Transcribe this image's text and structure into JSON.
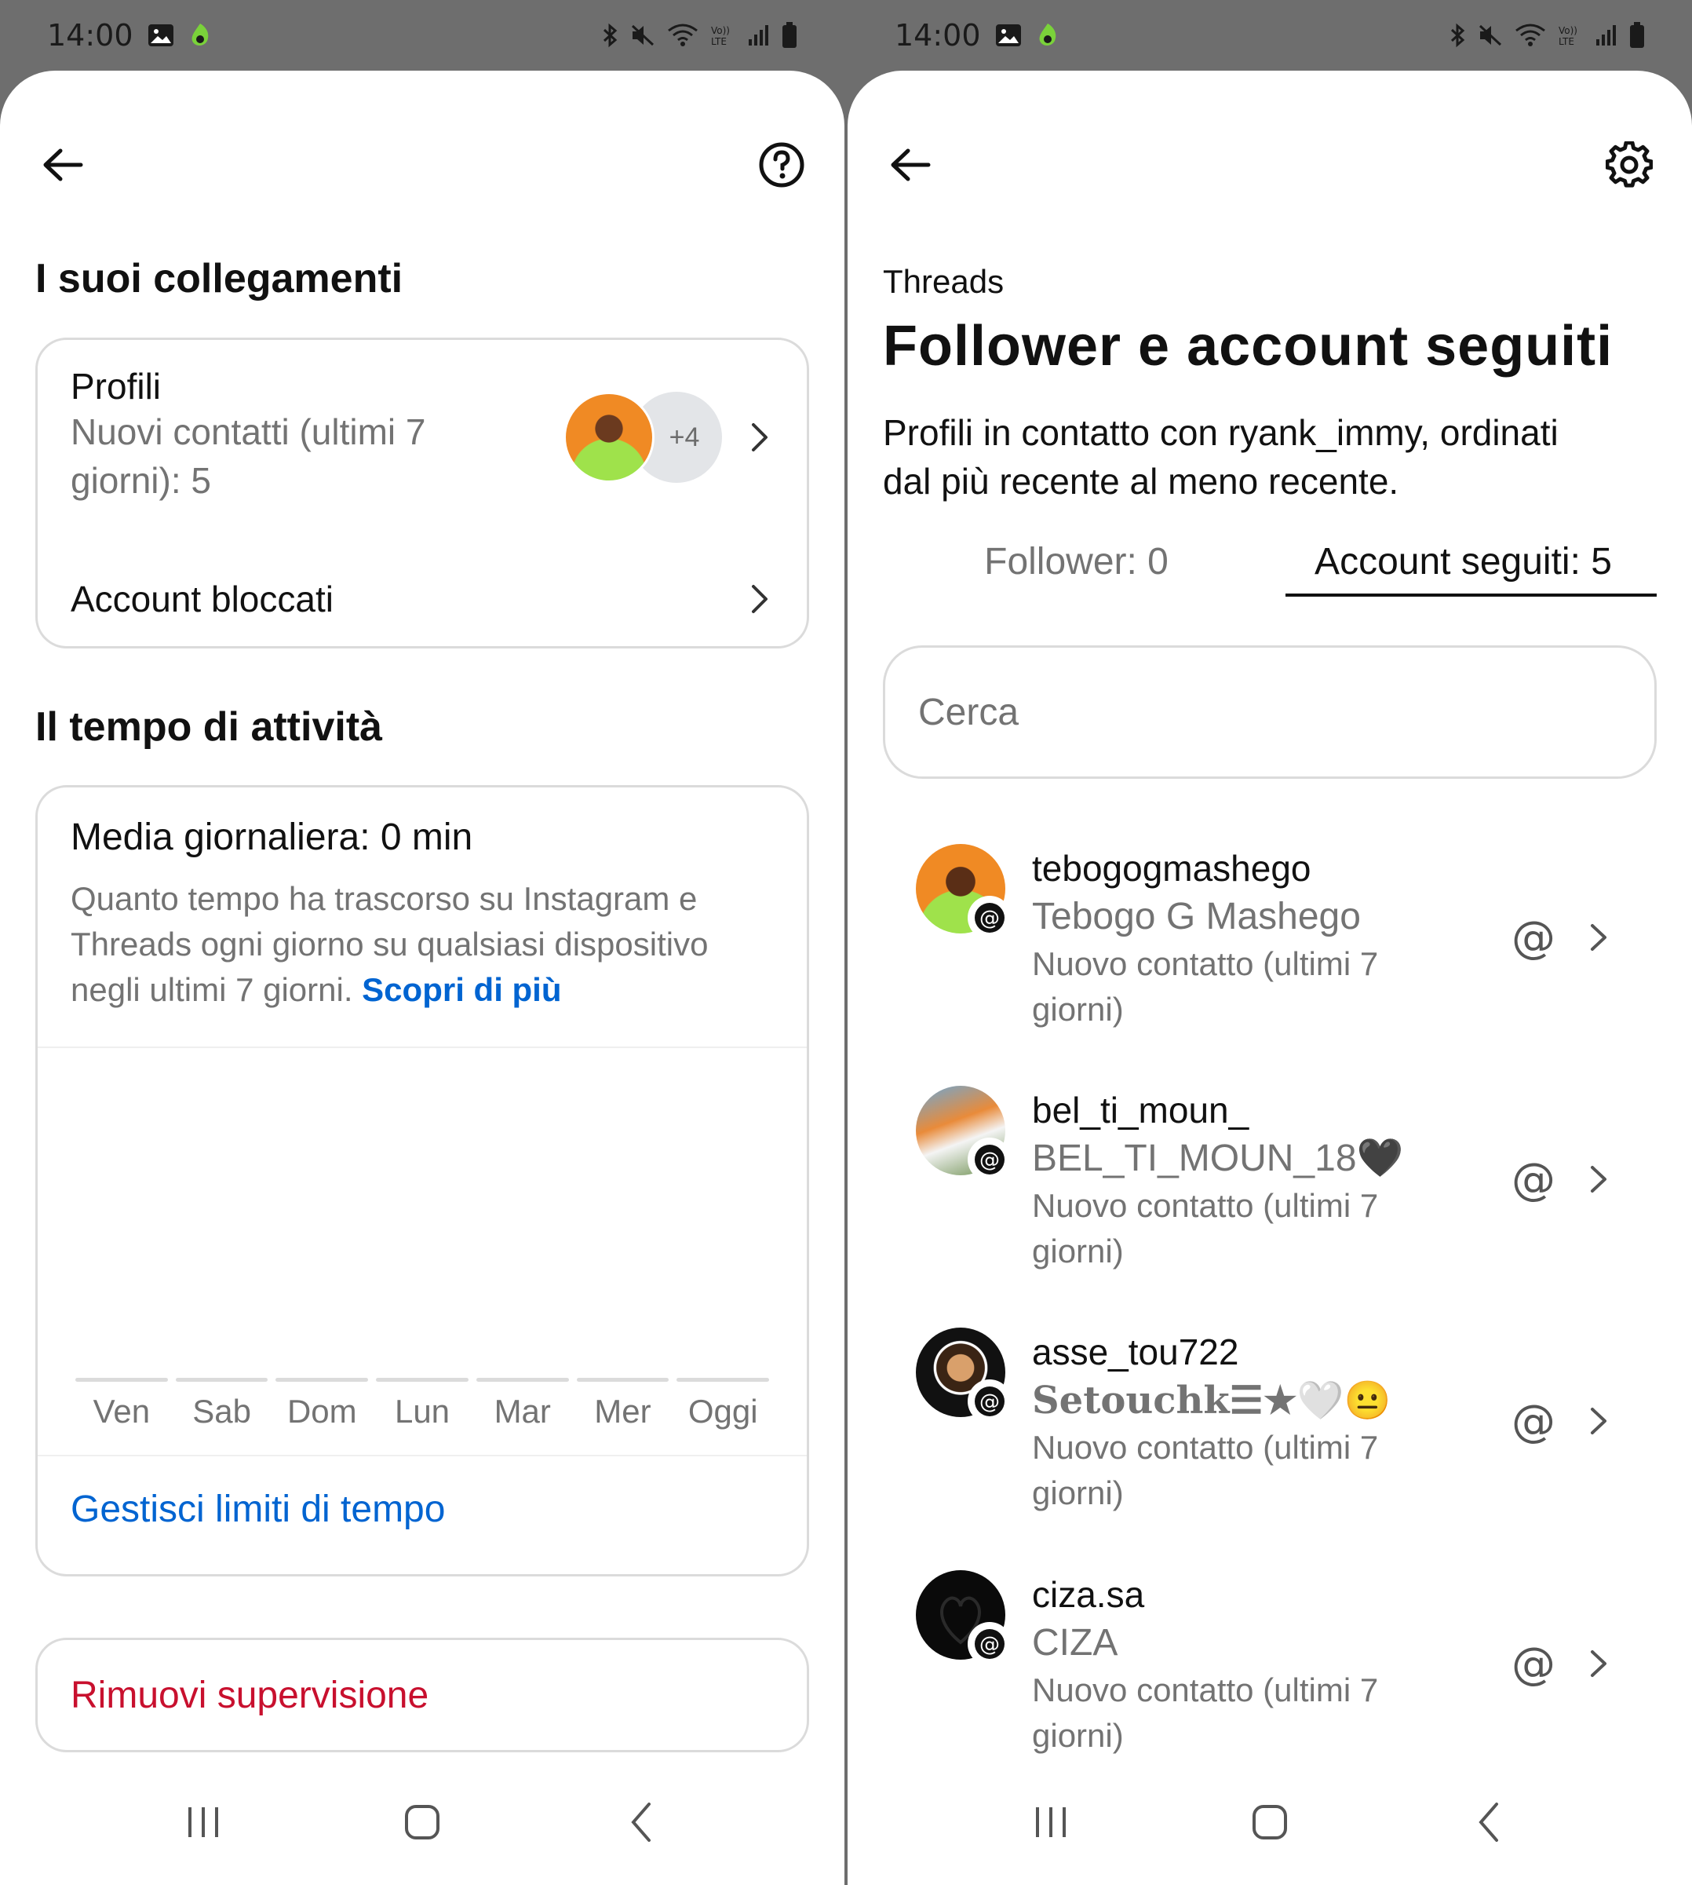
{
  "status": {
    "time": "14:00"
  },
  "left": {
    "section1_title": "I suoi collegamenti",
    "profiles": {
      "title": "Profili",
      "subtitle_line1": "Nuovi contatti (ultimi 7",
      "subtitle_line2": "giorni): 5",
      "more_count": "+4"
    },
    "blocked_label": "Account bloccati",
    "section2_title": "Il tempo di attività",
    "daily": {
      "title": "Media giornaliera: 0 min",
      "desc_line1": "Quanto tempo ha trascorso su Instagram e",
      "desc_line2": "Threads ogni giorno su qualsiasi dispositivo",
      "desc_line3": "negli ultimi 7 giorni. ",
      "learn_more": "Scopri di più",
      "days": [
        "Ven",
        "Sab",
        "Dom",
        "Lun",
        "Mar",
        "Mer",
        "Oggi"
      ],
      "manage_limits": "Gestisci limiti di tempo"
    },
    "remove_supervision": "Rimuovi supervisione"
  },
  "right": {
    "eyebrow": "Threads",
    "title": "Follower e account seguiti",
    "subtitle_line1": "Profili in contatto con ryank_immy, ordinati",
    "subtitle_line2": "dal più recente al meno recente.",
    "tabs": {
      "followers": "Follower: 0",
      "following": "Account seguiti: 5"
    },
    "search_placeholder": "Cerca",
    "users": [
      {
        "handle": "tebogogmashego",
        "name": "Tebogo G Mashego",
        "sub1": "Nuovo contatto (ultimi 7",
        "sub2": "giorni)"
      },
      {
        "handle": "bel_ti_moun_",
        "name": "BEL_TI_MOUN_18🖤",
        "sub1": "Nuovo contatto (ultimi 7",
        "sub2": "giorni)"
      },
      {
        "handle": "asse_tou722",
        "name": "Setouchk☰★🤍😐",
        "sub1": "Nuovo contatto (ultimi 7",
        "sub2": "giorni)"
      },
      {
        "handle": "ciza.sa",
        "name": "CIZA",
        "sub1": "Nuovo contatto (ultimi 7",
        "sub2": "giorni)"
      }
    ]
  }
}
